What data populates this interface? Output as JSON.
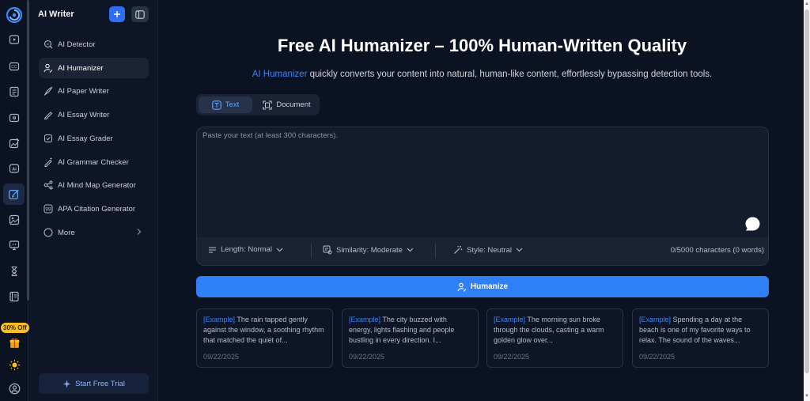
{
  "rail": {
    "icons": [
      "logo-icon",
      "video-icon",
      "caption-icon",
      "document-list-icon",
      "audio-wave-icon",
      "image-edit-icon",
      "ai-icon",
      "pen-write-icon",
      "image-gallery-icon",
      "presentation-icon",
      "hourglass-icon",
      "book-icon",
      "gift-icon",
      "sun-icon",
      "user-icon"
    ],
    "promo_label": "30% Off"
  },
  "sidebar": {
    "title": "AI Writer",
    "items": [
      {
        "label": "AI Detector",
        "icon": "detector-icon",
        "active": false
      },
      {
        "label": "AI Humanizer",
        "icon": "humanizer-icon",
        "active": true
      },
      {
        "label": "AI Paper Writer",
        "icon": "feather-pen-icon",
        "active": false
      },
      {
        "label": "AI Essay Writer",
        "icon": "pencil-icon",
        "active": false
      },
      {
        "label": "AI Essay Grader",
        "icon": "grade-icon",
        "active": false
      },
      {
        "label": "AI Grammar Checker",
        "icon": "grammar-icon",
        "active": false
      },
      {
        "label": "AI Mind Map Generator",
        "icon": "mind-map-icon",
        "active": false
      },
      {
        "label": "APA Citation Generator",
        "icon": "quote-icon",
        "active": false
      },
      {
        "label": "More",
        "icon": "more-circle-icon",
        "active": false
      }
    ],
    "trial_label": "Start Free Trial"
  },
  "main": {
    "headline": "Free AI Humanizer – 100% Human-Written Quality",
    "subline_accent": "AI Humanizer",
    "subline_rest": " quickly converts your content into natural, human-like content, effortlessly bypassing detection tools.",
    "tabs": [
      {
        "label": "Text",
        "active": true
      },
      {
        "label": "Document",
        "active": false
      }
    ],
    "editor": {
      "placeholder": "Paste your text (at least 300 characters).",
      "value": "",
      "length_label": "Length: Normal",
      "similarity_label": "Similarity: Moderate",
      "style_label": "Style: Neutral",
      "char_count": "0/5000 characters (0 words)"
    },
    "humanize_label": "Humanize",
    "examples": [
      {
        "tag": "[Example]",
        "text": " The rain tapped gently against the window, a soothing rhythm that matched the quiet of...",
        "date": "09/22/2025"
      },
      {
        "tag": "[Example]",
        "text": " The city buzzed with energy, lights flashing and people bustling in every direction. I...",
        "date": "09/22/2025"
      },
      {
        "tag": "[Example]",
        "text": " The morning sun broke through the clouds, casting a warm golden glow over...",
        "date": "09/22/2025"
      },
      {
        "tag": "[Example]",
        "text": " Spending a day at the beach is one of my favorite ways to relax. The sound of the waves...",
        "date": "09/22/2025"
      }
    ]
  },
  "colors": {
    "accent": "#2f7ff6",
    "background": "#0b1221",
    "panel": "#141b2b",
    "promo": "#fbbf24"
  }
}
